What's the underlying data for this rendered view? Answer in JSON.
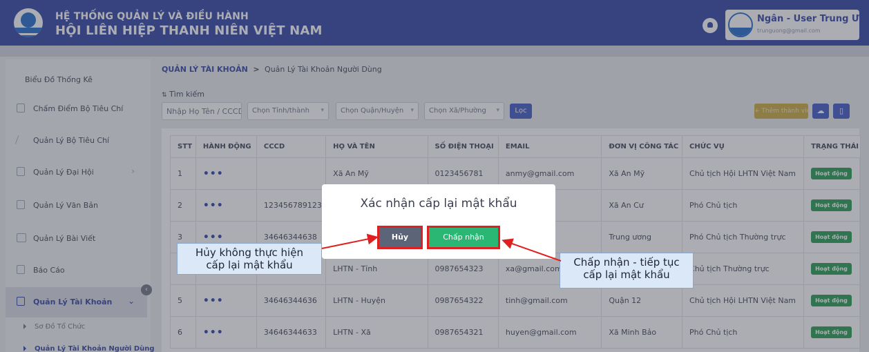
{
  "header": {
    "title_line1": "HỆ THỐNG QUẢN LÝ VÀ ĐIỀU HÀNH",
    "title_line2": "HỘI LIÊN HIỆP THANH NIÊN VIỆT NAM",
    "user_name": "Ngân - User Trung Ương",
    "user_email": "trunguong@gmail.com"
  },
  "sidebar": {
    "items": [
      {
        "label": "Biểu Đồ Thống Kê"
      },
      {
        "label": "Chấm Điểm Bộ Tiêu Chí"
      },
      {
        "label": "Quản Lý Bộ Tiêu Chí"
      },
      {
        "label": "Quản Lý Đại Hội"
      },
      {
        "label": "Quản Lý Văn Bản"
      },
      {
        "label": "Quản Lý Bài Viết"
      },
      {
        "label": "Báo Cáo"
      },
      {
        "label": "Quản Lý Tài Khoản"
      }
    ],
    "sub_items": [
      {
        "label": "Sơ Đồ Tổ Chức"
      },
      {
        "label": "Quản Lý Tài Khoản Người Dùng"
      }
    ]
  },
  "breadcrumb": {
    "first": "QUẢN LÝ TÀI KHOẢN",
    "separator": ">",
    "second": "Quản Lý Tài Khoản Người Dùng"
  },
  "filters": {
    "title": "Tìm kiếm",
    "name_placeholder": "Nhập Họ Tên / CCCD",
    "province": "Chọn Tỉnh/thành",
    "district": "Chọn Quận/Huyện",
    "ward": "Chọn Xã/Phường",
    "filter_button": "Lọc",
    "add_button": "+ Thêm thành viên"
  },
  "table": {
    "headers": [
      "STT",
      "HÀNH ĐỘNG",
      "CCCD",
      "HỌ VÀ TÊN",
      "SỐ ĐIỆN THOẠI",
      "EMAIL",
      "ĐƠN VỊ CÔNG TÁC",
      "CHỨC VỤ",
      "TRẠNG THÁI"
    ],
    "action_dots": "•••",
    "rows": [
      {
        "stt": "1",
        "cccd": "",
        "name": "Xã An Mỹ",
        "phone": "0123456781",
        "email": "anmy@gmail.com",
        "unit": "Xã An Mỹ",
        "position": "Chủ tịch Hội LHTN Việt Nam",
        "status": "Hoạt động"
      },
      {
        "stt": "2",
        "cccd": "123456789123",
        "name": "",
        "phone": "",
        "email": "",
        "unit": "Xã An Cư",
        "position": "Phó Chủ tịch",
        "status": "Hoạt động"
      },
      {
        "stt": "3",
        "cccd": "34646344638",
        "name": "",
        "phone": "",
        "email": "ail.com",
        "unit": "Trung ương",
        "position": "Phó Chủ tịch Thường trực",
        "status": "Hoạt động"
      },
      {
        "stt": "",
        "cccd": "",
        "name": "LHTN - Tỉnh",
        "phone": "0987654323",
        "email": "xa@gmail.com",
        "unit": "",
        "position": "Chủ tịch Thường trực",
        "status": "Hoạt động"
      },
      {
        "stt": "5",
        "cccd": "34646344636",
        "name": "LHTN - Huyện",
        "phone": "0987654322",
        "email": "tinh@gmail.com",
        "unit": "Quận 12",
        "position": "Chủ tịch Hội LHTN Việt Nam",
        "status": "Hoạt động"
      },
      {
        "stt": "6",
        "cccd": "34646344633",
        "name": "LHTN - Xã",
        "phone": "0987654321",
        "email": "huyen@gmail.com",
        "unit": "Xã Minh Bảo",
        "position": "Phó Chủ tịch",
        "status": "Hoạt động"
      }
    ]
  },
  "modal": {
    "title": "Xác nhận cấp lại mật khẩu",
    "cancel": "Hủy",
    "accept": "Chấp nhận"
  },
  "callouts": {
    "left_line1": "Hủy không thực hiện",
    "left_line2": "cấp lại mật khẩu",
    "right_line1": "Chấp nhận - tiếp tục",
    "right_line2": "cấp lại mật khẩu"
  },
  "colors": {
    "header": "#2a3fa0",
    "accept": "#2ab673",
    "cancel": "#5b6577",
    "highlight": "#e02020",
    "badge": "#1f9a4c"
  }
}
